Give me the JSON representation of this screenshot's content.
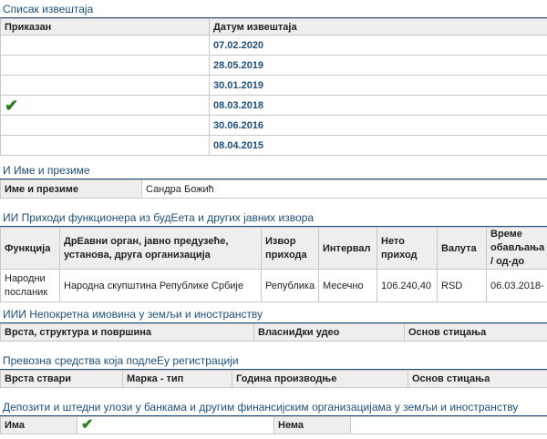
{
  "reports": {
    "title": "Списак извештаја",
    "col_shown": "Приказан",
    "col_date": "Датум извештаја",
    "rows": [
      {
        "date": "07.02.2020",
        "shown": false
      },
      {
        "date": "28.05.2019",
        "shown": false
      },
      {
        "date": "30.01.2019",
        "shown": false
      },
      {
        "date": "08.03.2018",
        "shown": true
      },
      {
        "date": "30.06.2016",
        "shown": false
      },
      {
        "date": "08.04.2015",
        "shown": false
      }
    ]
  },
  "name_section": {
    "title": "И Име и презиме",
    "label": "Име и презиме",
    "value": "Сандра Божић"
  },
  "income": {
    "title": "ИИ Приходи функционера из будЕета и других јавних извора",
    "headers": {
      "function": "Функција",
      "body": "ДрЕавни орган, јавно предузеће, установа, друга организација",
      "source": "Извор прихода",
      "interval": "Интервал",
      "net": "Нето приход",
      "currency": "Валута",
      "period": "Време обављања / од-до"
    },
    "row": {
      "function": "Народни посланик",
      "body": "Народна скупштина Републике Србије",
      "source": "Република",
      "interval": "Месечно",
      "net": "106.240,40",
      "currency": "RSD",
      "period": "06.03.2018-"
    }
  },
  "property": {
    "title": "ИИИ Непокретна имовина у земљи и иностранству",
    "headers": [
      "Врста, структура и површина",
      "ВласниДки удео",
      "Основ стицања"
    ]
  },
  "vehicles": {
    "title": "Превозна средства која подлеЕу регистрацији",
    "headers": [
      "Врста ствари",
      "Марка - тип",
      "Година производње",
      "Основ стицања"
    ]
  },
  "deposits": {
    "title": "Депозити и штедни улози у банкама и другим финансијским организацијама у земљи и иностранству",
    "has_label": "Има",
    "none_label": "Нема",
    "has": true
  },
  "colors": {
    "accent": "#1f4f7a",
    "check": "#2e7d1e",
    "header_bg": "#eeeeee"
  },
  "icons": {
    "shown": "check-icon"
  }
}
